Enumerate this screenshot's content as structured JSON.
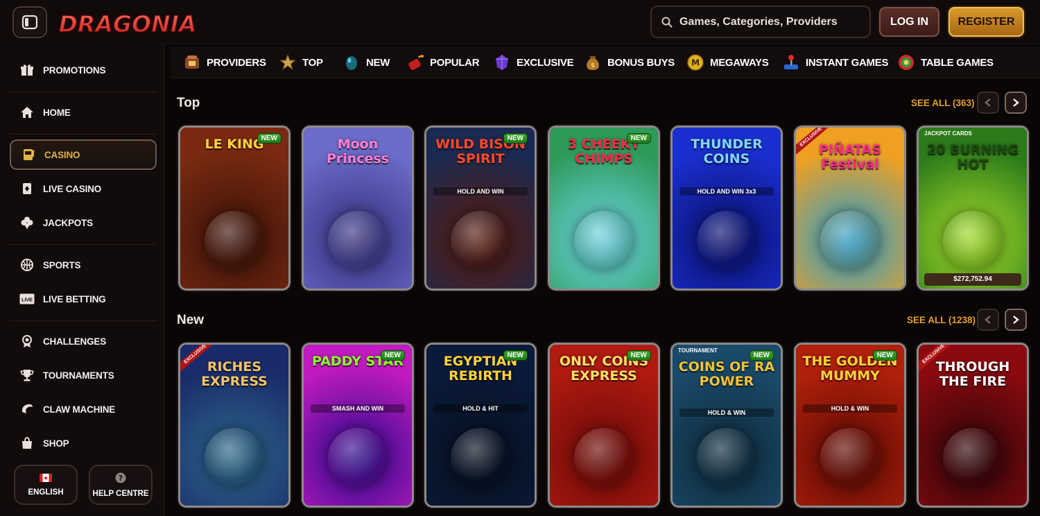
{
  "header": {
    "logo_text": "DRAGONIA",
    "search_placeholder": "Games, Categories, Providers",
    "login_label": "LOG IN",
    "register_label": "REGISTER"
  },
  "sidebar": {
    "items": [
      {
        "label": "PROMOTIONS",
        "icon": "gift-icon"
      },
      {
        "label": "HOME",
        "icon": "home-icon"
      },
      {
        "label": "CASINO",
        "icon": "slot-machine-icon",
        "active": true
      },
      {
        "label": "LIVE CASINO",
        "icon": "playing-card-icon"
      },
      {
        "label": "JACKPOTS",
        "icon": "clover-icon"
      },
      {
        "label": "SPORTS",
        "icon": "basketball-icon"
      },
      {
        "label": "LIVE BETTING",
        "icon": "live-badge-icon"
      },
      {
        "label": "CHALLENGES",
        "icon": "medal-icon"
      },
      {
        "label": "TOURNAMENTS",
        "icon": "trophy-icon"
      },
      {
        "label": "CLAW MACHINE",
        "icon": "claw-icon"
      },
      {
        "label": "SHOP",
        "icon": "shopping-bag-icon"
      }
    ],
    "language_label": "ENGLISH",
    "help_label": "HELP CENTRE",
    "live_badge": "LIVE"
  },
  "categories": [
    {
      "label": "PROVIDERS",
      "icon": "providers-icon"
    },
    {
      "label": "TOP",
      "icon": "star-icon"
    },
    {
      "label": "NEW",
      "icon": "egg-icon"
    },
    {
      "label": "POPULAR",
      "icon": "dynamite-icon"
    },
    {
      "label": "EXCLUSIVE",
      "icon": "gem-icon"
    },
    {
      "label": "BONUS BUYS",
      "icon": "money-bag-icon"
    },
    {
      "label": "MEGAWAYS",
      "icon": "megaways-coin-icon"
    },
    {
      "label": "INSTANT GAMES",
      "icon": "joystick-icon"
    },
    {
      "label": "TABLE GAMES",
      "icon": "poker-chip-icon"
    }
  ],
  "sections": {
    "top": {
      "title": "Top",
      "see_all": "SEE ALL (363)",
      "games": [
        {
          "title": "LE KING",
          "badge": "NEW",
          "colors": [
            "#7a2a10",
            "#3a120a"
          ],
          "text_color": "#ffd23a"
        },
        {
          "title": "Moon Princess",
          "badge": "",
          "colors": [
            "#6b6cc9",
            "#35307d"
          ],
          "text_color": "#ff7fd4"
        },
        {
          "title": "WILD BISON SPIRIT",
          "badge": "NEW",
          "colors": [
            "#1b2a52",
            "#5a1a0a"
          ],
          "text_color": "#ff4a2a",
          "subtitle": "HOLD AND WIN"
        },
        {
          "title": "3 CHEEKY CHIMPS",
          "badge": "NEW",
          "colors": [
            "#2e9a5a",
            "#6fd6e6"
          ],
          "text_color": "#ff2a4a"
        },
        {
          "title": "THUNDER COINS",
          "badge": "",
          "colors": [
            "#1a2fd0",
            "#0a0f6a"
          ],
          "text_color": "#7fd8ff",
          "subtitle": "HOLD AND WIN 3x3"
        },
        {
          "title": "PIÑATAS Festival",
          "badge": "",
          "exclusive": "EXCLUSIVE",
          "colors": [
            "#f0a020",
            "#2aa0d0"
          ],
          "text_color": "#ff2a8a"
        },
        {
          "title": "20 BURNING HOT",
          "badge": "",
          "top_label": "JACKPOT CARDS",
          "jackpot": "$272,752.94",
          "colors": [
            "#2c7a1a",
            "#a6e02a"
          ],
          "text_color": "#1e4a10"
        }
      ]
    },
    "new": {
      "title": "New",
      "see_all": "SEE ALL (1238)",
      "games": [
        {
          "title": "RICHES EXPRESS",
          "badge": "",
          "exclusive": "EXCLUSIVE",
          "colors": [
            "#1a2a6a",
            "#2c6a8a"
          ],
          "text_color": "#f0c46a"
        },
        {
          "title": "PADDY STAR",
          "badge": "NEW",
          "colors": [
            "#c01ac0",
            "#2a0a8a"
          ],
          "text_color": "#8aff2a",
          "subtitle": "SMASH AND WIN"
        },
        {
          "title": "EGYPTIAN REBIRTH",
          "badge": "NEW",
          "colors": [
            "#0a1a3a",
            "#07101f"
          ],
          "text_color": "#ffd23a",
          "subtitle": "HOLD & HIT"
        },
        {
          "title": "ONLY COINS EXPRESS",
          "badge": "NEW",
          "colors": [
            "#b01a10",
            "#6a0a08"
          ],
          "text_color": "#ffe066"
        },
        {
          "title": "COINS OF RA POWER",
          "badge": "NEW",
          "top_label": "TOURNAMENT",
          "colors": [
            "#1a4a6a",
            "#0e2a3a"
          ],
          "text_color": "#f0c43a",
          "subtitle": "HOLD & WIN"
        },
        {
          "title": "THE GOLDEN MUMMY",
          "badge": "NEW",
          "colors": [
            "#b0200a",
            "#5a0a05"
          ],
          "text_color": "#ffd23a",
          "subtitle": "HOLD & WIN"
        },
        {
          "title": "THROUGH THE FIRE",
          "badge": "",
          "exclusive": "EXCLUSIVE",
          "colors": [
            "#8a0a10",
            "#2a0508"
          ],
          "text_color": "#ffffff"
        }
      ]
    }
  },
  "colors": {
    "accent": "#e1a023",
    "background": "#0b0606",
    "panel": "#120b0b"
  }
}
